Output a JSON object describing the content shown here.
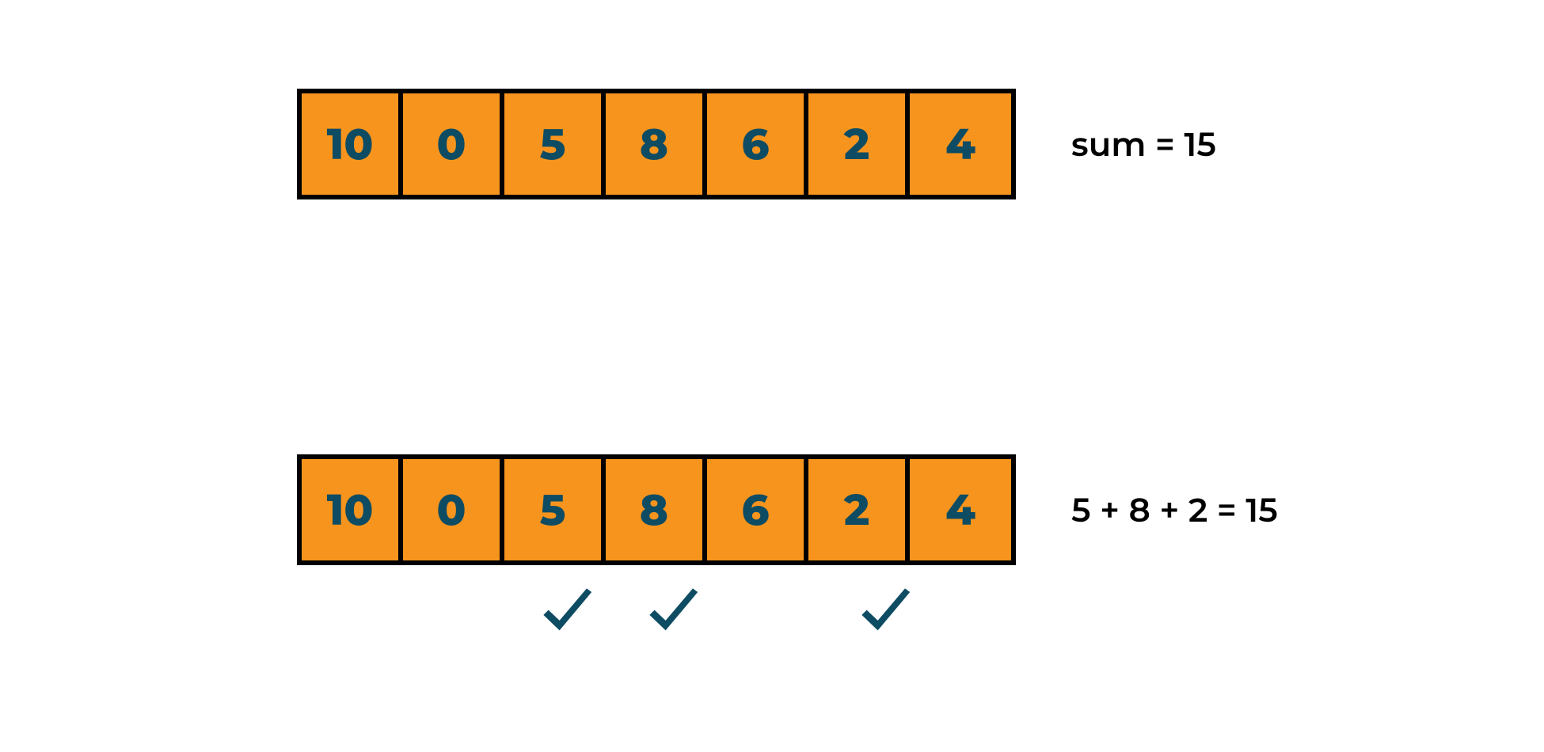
{
  "colors": {
    "cell_fill": "#F7941D",
    "cell_text": "#0E4C63",
    "check": "#0E4C63",
    "border": "#000000"
  },
  "row1": {
    "values": [
      "10",
      "0",
      "5",
      "8",
      "6",
      "2",
      "4"
    ],
    "caption": "sum = 15"
  },
  "row2": {
    "values": [
      "10",
      "0",
      "5",
      "8",
      "6",
      "2",
      "4"
    ],
    "caption": "5 + 8 + 2 = 15",
    "checked_indices": [
      2,
      3,
      5
    ]
  },
  "target_sum": 15
}
